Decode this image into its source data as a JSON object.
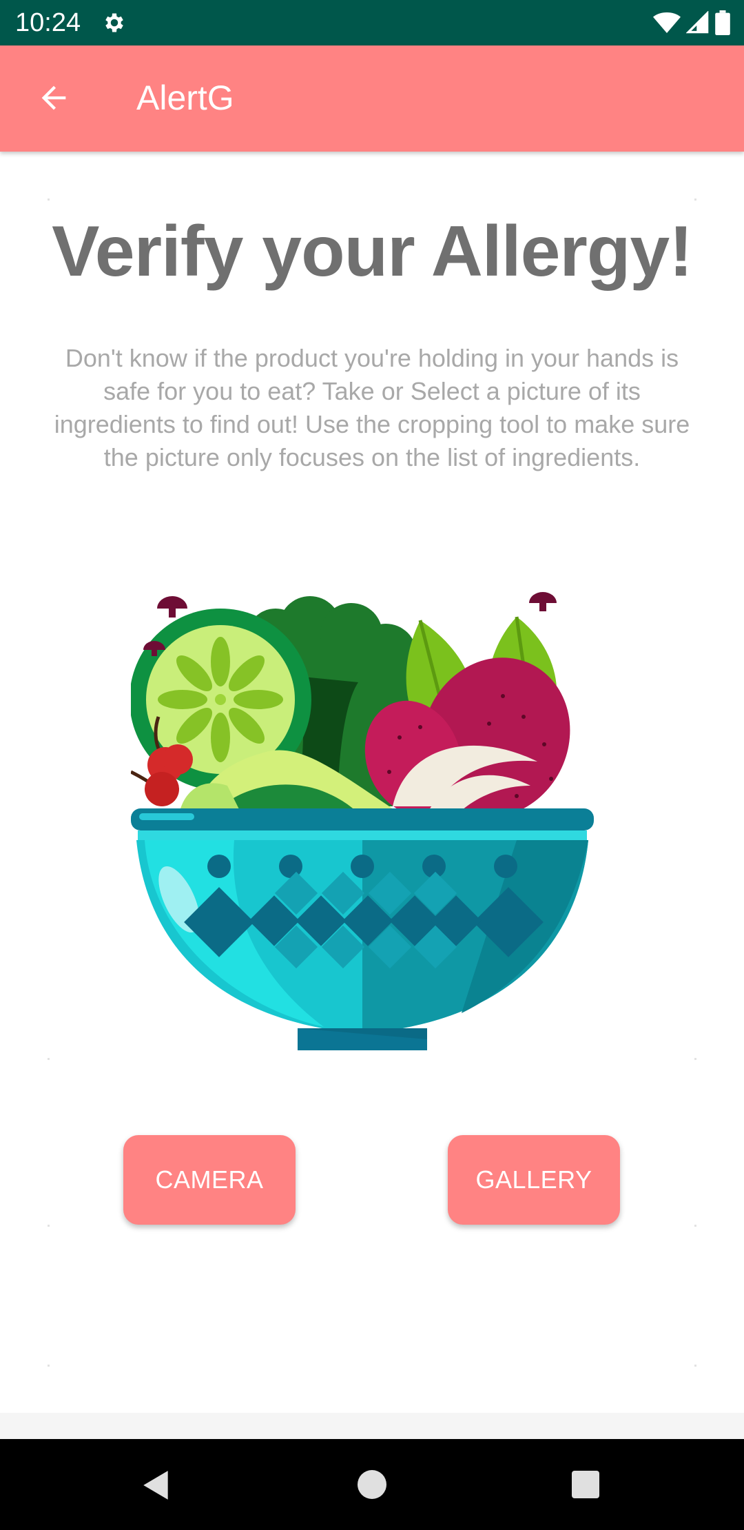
{
  "status_bar": {
    "time": "10:24",
    "icons": [
      "gear-icon",
      "wifi-icon",
      "signal-icon",
      "battery-icon"
    ]
  },
  "app_bar": {
    "title": "AlertG",
    "back_icon": "arrow-back-icon"
  },
  "main": {
    "heading": "Verify your Allergy!",
    "description": "Don't know if the product you're holding in your hands is safe for you to eat? Take or Select a picture of its ingredients to find out! Use the cropping tool to make sure the picture only focuses on the list of ingredients.",
    "illustration": "salad-bowl-illustration",
    "buttons": {
      "camera_label": "CAMERA",
      "gallery_label": "GALLERY"
    }
  },
  "nav_bar": {
    "icons": [
      "nav-back-icon",
      "nav-home-icon",
      "nav-recents-icon"
    ]
  },
  "colors": {
    "status_bar": "#00574b",
    "accent": "#ff8383",
    "heading": "#707070",
    "description": "#a8a8a8"
  }
}
